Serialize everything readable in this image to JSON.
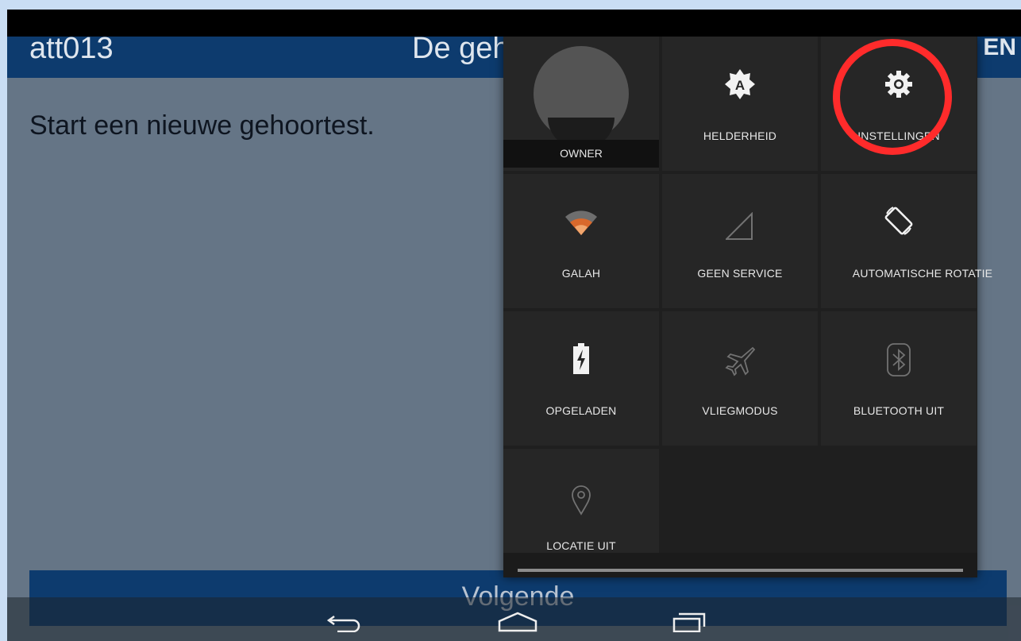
{
  "appbar": {
    "app_id": "att013",
    "title": "De gehoortest",
    "language": "EN"
  },
  "main": {
    "instruction": "Start een nieuwe gehoortest."
  },
  "footer": {
    "next_label": "Volgende"
  },
  "quick_settings": {
    "user_label": "OWNER",
    "tiles": [
      {
        "label": "HELDERHEID",
        "icon": "brightness-auto-icon"
      },
      {
        "label": "INSTELLINGEN",
        "icon": "gear-icon"
      },
      {
        "label": "GALAH",
        "icon": "wifi-icon"
      },
      {
        "label": "GEEN SERVICE",
        "icon": "signal-icon"
      },
      {
        "label": "AUTOMATISCHE ROTATIE",
        "icon": "auto-rotate-icon"
      },
      {
        "label": "OPGELADEN",
        "icon": "battery-charging-icon"
      },
      {
        "label": "VLIEGMODUS",
        "icon": "airplane-icon"
      },
      {
        "label": "BLUETOOTH UIT",
        "icon": "bluetooth-icon"
      },
      {
        "label": "LOCATIE UIT",
        "icon": "location-icon"
      }
    ]
  },
  "navbar": {
    "buttons": [
      "back-icon",
      "home-icon",
      "recent-apps-icon"
    ]
  },
  "colors": {
    "appbar": "#0d3b6e",
    "highlight": "#ff2b2b",
    "wifi": "#d9692c"
  }
}
